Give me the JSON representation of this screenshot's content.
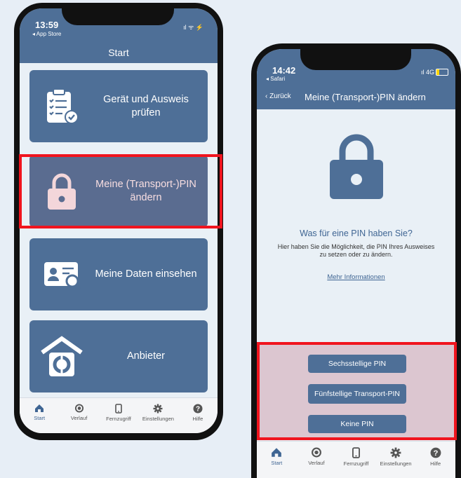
{
  "left_phone": {
    "status": {
      "time": "13:59",
      "back": "◂ App Store",
      "icons": "ıl ᯤ ⚡"
    },
    "nav_title": "Start",
    "tiles": [
      {
        "label": "Gerät und Ausweis prüfen",
        "icon": "checklist-icon"
      },
      {
        "label": "Meine (Transport-)PIN ändern",
        "icon": "lock-icon"
      },
      {
        "label": "Meine Daten einsehen",
        "icon": "id-card-icon"
      },
      {
        "label": "Anbieter",
        "icon": "provider-house-icon"
      }
    ],
    "tabbar": [
      {
        "label": "Start",
        "icon": "home-icon"
      },
      {
        "label": "Verlauf",
        "icon": "history-icon"
      },
      {
        "label": "Fernzugriff",
        "icon": "phone-icon"
      },
      {
        "label": "Einstellungen",
        "icon": "gear-icon"
      },
      {
        "label": "Hilfe",
        "icon": "help-icon"
      }
    ]
  },
  "right_phone": {
    "status": {
      "time": "14:42",
      "back": "◂ Safari",
      "icons": "ıl 4G"
    },
    "nav": {
      "back_label": "Zurück",
      "title": "Meine (Transport-)PIN ändern"
    },
    "heading": "Was für eine PIN haben Sie?",
    "description": "Hier haben Sie die Möglichkeit, die PIN Ihres Ausweises zu setzen oder zu ändern.",
    "more_info_link": "Mehr Informationen",
    "buttons": [
      "Sechsstellige PIN",
      "Fünfstellige Transport-PIN",
      "Keine PIN"
    ],
    "tabbar": [
      {
        "label": "Start",
        "icon": "home-icon"
      },
      {
        "label": "Verlauf",
        "icon": "history-icon"
      },
      {
        "label": "Fernzugriff",
        "icon": "phone-icon"
      },
      {
        "label": "Einstellungen",
        "icon": "gear-icon"
      },
      {
        "label": "Hilfe",
        "icon": "help-icon"
      }
    ]
  },
  "colors": {
    "brand": "#4e6f97",
    "highlight": "#f0141e",
    "background": "#e9f0f6"
  }
}
